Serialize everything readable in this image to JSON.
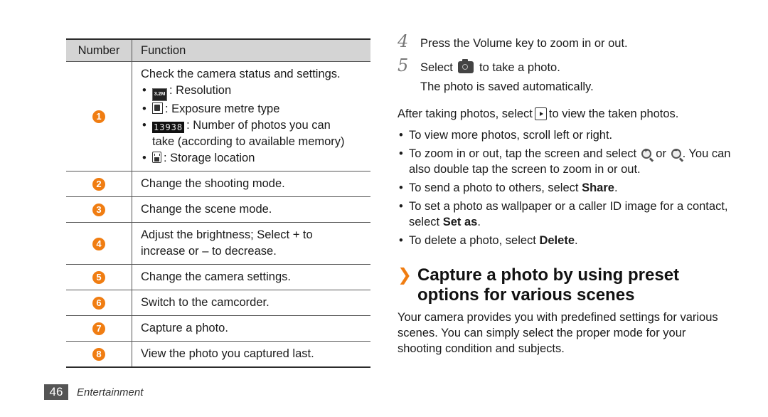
{
  "table": {
    "headers": {
      "number": "Number",
      "function": "Function"
    },
    "rows": [
      {
        "number": "1",
        "intro": "Check the camera status and settings.",
        "items": [
          {
            "icon": "resolution-icon",
            "icon_text": "3.2M",
            "label": ": Resolution"
          },
          {
            "icon": "exposure-metre-icon",
            "label": ": Exposure metre type"
          },
          {
            "icon": "photo-count-icon",
            "icon_text": "13938",
            "label": ": Number of photos you can",
            "label_cont": "take (according to available memory)"
          },
          {
            "icon": "storage-location-icon",
            "label": ": Storage location"
          }
        ]
      },
      {
        "number": "2",
        "text": "Change the shooting mode."
      },
      {
        "number": "3",
        "text": "Change the scene mode."
      },
      {
        "number": "4",
        "text": "Adjust the brightness; Select + to",
        "text_cont": "increase or – to decrease."
      },
      {
        "number": "5",
        "text": "Change the camera settings."
      },
      {
        "number": "6",
        "text": "Switch to the camcorder."
      },
      {
        "number": "7",
        "text": "Capture a photo."
      },
      {
        "number": "8",
        "text": "View the photo you captured last."
      }
    ]
  },
  "steps": [
    {
      "num": "4",
      "text": "Press the Volume key to zoom in or out."
    },
    {
      "num": "5",
      "pre": "Select",
      "icon": "camera-icon",
      "post": "to take a photo.",
      "sub": "The photo is saved automatically."
    }
  ],
  "after": {
    "pre": "After taking photos, select",
    "icon": "play-icon",
    "post": "to view the taken photos."
  },
  "bullets": [
    {
      "text": "To view more photos, scroll left or right."
    },
    {
      "pre": "To zoom in or out, tap the screen and select",
      "mid": "or",
      "post": ". You can also double tap the screen to zoom in or out."
    },
    {
      "pre": "To send a photo to others, select ",
      "bold": "Share",
      "post": "."
    },
    {
      "pre": "To set a photo as wallpaper or a caller ID image for a contact, select ",
      "bold": "Set as",
      "post": "."
    },
    {
      "pre": "To delete a photo, select ",
      "bold": "Delete",
      "post": "."
    }
  ],
  "section": {
    "chevron": "❯",
    "title_line1": "Capture a photo by using preset",
    "title_line2": "options for various scenes",
    "body": "Your camera provides you with predefined settings for various scenes. You can simply select the proper mode for your shooting condition and subjects."
  },
  "footer": {
    "page": "46",
    "label": "Entertainment"
  },
  "colors": {
    "accent": "#f07d12",
    "header_bg": "#d4d4d4",
    "page_badge": "#555555"
  }
}
